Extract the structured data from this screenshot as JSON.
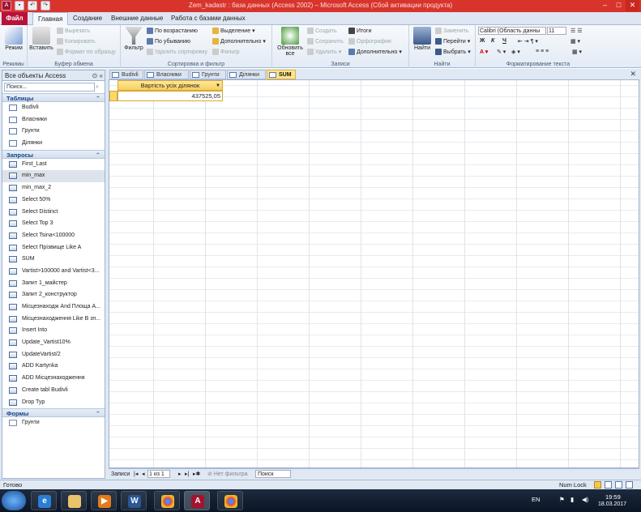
{
  "window": {
    "title": "Zem_kadastr : база данных (Access 2002) – Microsoft Access (Сбой активации продукта)",
    "controls": [
      "–",
      "□",
      "✕"
    ]
  },
  "ribbon_tabs": [
    "Файл",
    "Главная",
    "Создание",
    "Внешние данные",
    "Работа с базами данных"
  ],
  "ribbon": {
    "views": {
      "label": "Режимы",
      "button": "Режим"
    },
    "clipboard": {
      "label": "Буфер обмена",
      "paste": "Вставить",
      "cut": "Вырезать",
      "copy": "Копировать",
      "format": "Формат по образцу"
    },
    "sort": {
      "label": "Сортировка и фильтр",
      "filter": "Фильтр",
      "asc": "По возрастанию",
      "desc": "По убыванию",
      "remove": "Удалить сортировку",
      "selection": "Выделение",
      "advanced": "Дополнительно",
      "toggle": "Фильтр"
    },
    "records": {
      "label": "Записи",
      "refresh": "Обновить все",
      "new": "Создать",
      "save": "Сохранить",
      "delete": "Удалить",
      "totals": "Итоги",
      "spelling": "Орфография",
      "more": "Дополнительно"
    },
    "find": {
      "label": "Найти",
      "find": "Найти",
      "replace": "Заменить",
      "goto": "Перейти",
      "select": "Выбрать"
    },
    "text": {
      "label": "Форматирование текста",
      "font": "Calibri (Область данны",
      "size": "11",
      "bold": "Ж",
      "italic": "К",
      "underline": "Ч"
    }
  },
  "nav": {
    "header": "Все объекты Access",
    "search_placeholder": "Поиск...",
    "sections": [
      {
        "title": "Таблицы",
        "items": [
          "Budivli",
          "Власники",
          "Грунти",
          "Ділянки"
        ]
      },
      {
        "title": "Запросы",
        "items": [
          "First_Last",
          "min_max",
          "min_max_2",
          "Select 50%",
          "Select Distinct",
          "Select Top 3",
          "Select Tsina<100000",
          "Select Прізвище Like A",
          "SUM",
          "Vartist>100000 and Vartist<3...",
          "Запит 1_майстер",
          "Запит 2_конструктор",
          "Місцезнаходж And Площа A...",
          "Місцезнаходження Like B зп...",
          "Insert Into",
          "Update_Vartist10%",
          "UpdateVartist/2",
          "ADD Kartynka",
          "ADD Місцезнаходження",
          "Create tabl Budivli",
          "Drop Typ"
        ]
      },
      {
        "title": "Формы",
        "items": [
          "Грунти"
        ]
      }
    ],
    "selected": "min_max"
  },
  "doc_tabs": [
    "Budivli",
    "Власники",
    "Грунти",
    "Ділянки",
    "SUM"
  ],
  "active_tab": "SUM",
  "datasheet": {
    "column": "Вартість усіх ділянок",
    "value": "437525,05"
  },
  "record_nav": {
    "label": "Записи",
    "position": "1 из 1",
    "filter": "Нет фильтра",
    "search": "Поиск"
  },
  "status": {
    "left": "Готово",
    "numlock": "Num Lock"
  },
  "tray": {
    "lang": "EN",
    "time": "19:59",
    "date": "18.03.2017"
  }
}
